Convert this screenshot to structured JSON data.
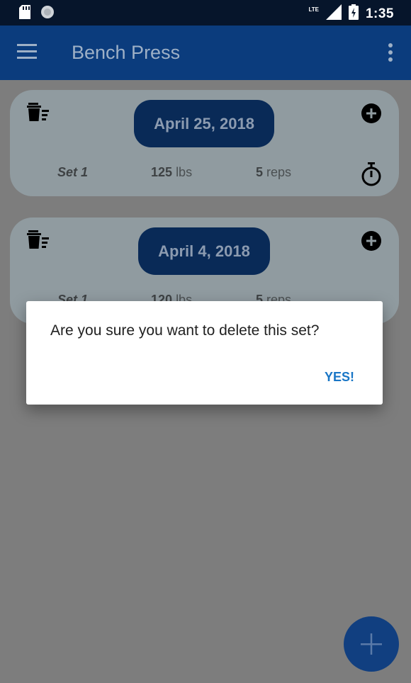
{
  "status_bar": {
    "time": "1:35",
    "network_label": "LTE",
    "icons": [
      "sd-card-icon",
      "circle-notification-icon",
      "signal-icon",
      "battery-charging-icon"
    ]
  },
  "app_bar": {
    "title": "Bench Press",
    "icons": [
      "menu-icon",
      "more-vert-icon"
    ]
  },
  "sessions": [
    {
      "date": "April 25, 2018",
      "set": {
        "label": "Set 1",
        "weight": "125",
        "weight_unit": "lbs",
        "reps": "5",
        "reps_unit": "reps"
      }
    },
    {
      "date": "April 4, 2018",
      "set": {
        "label": "Set 1",
        "weight": "120",
        "weight_unit": "lbs",
        "reps": "5",
        "reps_unit": "reps"
      }
    }
  ],
  "dialog": {
    "message": "Are you sure you want to delete this set?",
    "confirm_label": "YES!"
  },
  "fab": {
    "icon": "plus-icon"
  },
  "colors": {
    "status_bar": "#06152b",
    "app_bar": "#0b3c7d",
    "date_pill": "#092a57",
    "accent": "#1976c6",
    "scrim_background": "#7d7d7d",
    "card": "#909ba0"
  }
}
